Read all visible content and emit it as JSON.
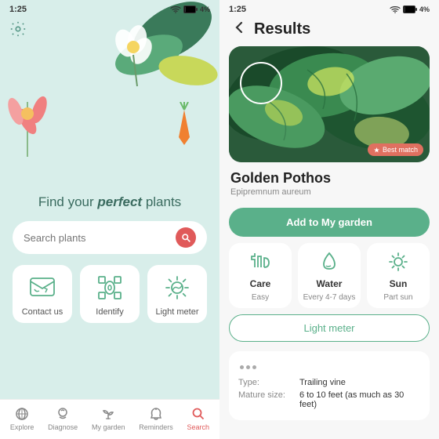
{
  "left": {
    "status_time": "1:25",
    "status_battery": "4%",
    "tagline": "Find your ",
    "tagline_em": "perfect",
    "tagline_end": " plants",
    "search_placeholder": "Search plants",
    "actions": [
      {
        "label": "Contact us",
        "icon": "contact-icon"
      },
      {
        "label": "Identify",
        "icon": "identify-icon"
      },
      {
        "label": "Light meter",
        "icon": "light-meter-icon"
      }
    ],
    "nav": [
      {
        "label": "Explore",
        "active": false
      },
      {
        "label": "Diagnose",
        "active": false
      },
      {
        "label": "My garden",
        "active": false
      },
      {
        "label": "Reminders",
        "active": false
      },
      {
        "label": "Search",
        "active": true
      }
    ]
  },
  "right": {
    "status_time": "1:25",
    "status_battery": "4%",
    "page_title": "Results",
    "plant_name": "Golden Pothos",
    "plant_latin": "Epipremnum aureum",
    "best_match": "Best match",
    "add_btn": "Add to My garden",
    "care": [
      {
        "title": "Care",
        "value": "Easy",
        "icon": "care-icon"
      },
      {
        "title": "Water",
        "value": "Every 4-7 days",
        "icon": "water-icon"
      },
      {
        "title": "Sun",
        "value": "Part sun",
        "icon": "sun-icon"
      }
    ],
    "light_meter_btn": "Light meter",
    "details": [
      {
        "label": "Type:",
        "value": "Trailing vine"
      },
      {
        "label": "Mature size:",
        "value": "6 to 10 feet (as much as 30 feet)"
      }
    ]
  }
}
